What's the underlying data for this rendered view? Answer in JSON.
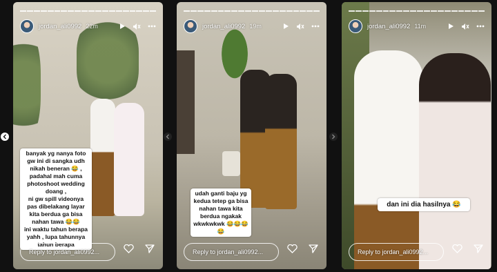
{
  "account": {
    "username": "jordan_ali0992"
  },
  "stories": [
    {
      "time": "22m",
      "caption": [
        "banyak yg nanya foto",
        "gw ini di sangka udh",
        "nikah beneran 😂 ,",
        "padahal mah cuma",
        "photoshoot wedding",
        "doang ,",
        "ni gw spill videonya",
        "pas dibelakang layar",
        "kita berdua ga bisa",
        "nahan tawa 😂😂",
        "ini waktu tahun berapa",
        "yahh , lupa tahunnya",
        "tahun berapa"
      ]
    },
    {
      "time": "19m",
      "caption": [
        "udah ganti baju yg",
        "kedua tetep ga bisa",
        "nahan tawa kita",
        "berdua ngakak",
        "wkwkwkwk 😂😂😂",
        "😂"
      ]
    },
    {
      "time": "11m",
      "caption": [
        "dan ini dia hasilnya 😂"
      ]
    }
  ],
  "reply_placeholder": "Reply to jordan_ali0992...",
  "icons": {
    "play": "play-icon",
    "mute": "mute-icon",
    "more": "more-icon",
    "like": "heart-icon",
    "send": "send-icon",
    "prev": "chevron-left-icon",
    "next": "chevron-right-icon"
  },
  "colors": {
    "caption_bg": "#ffffff",
    "ui_white": "#ffffff",
    "page_bg": "#111111"
  }
}
